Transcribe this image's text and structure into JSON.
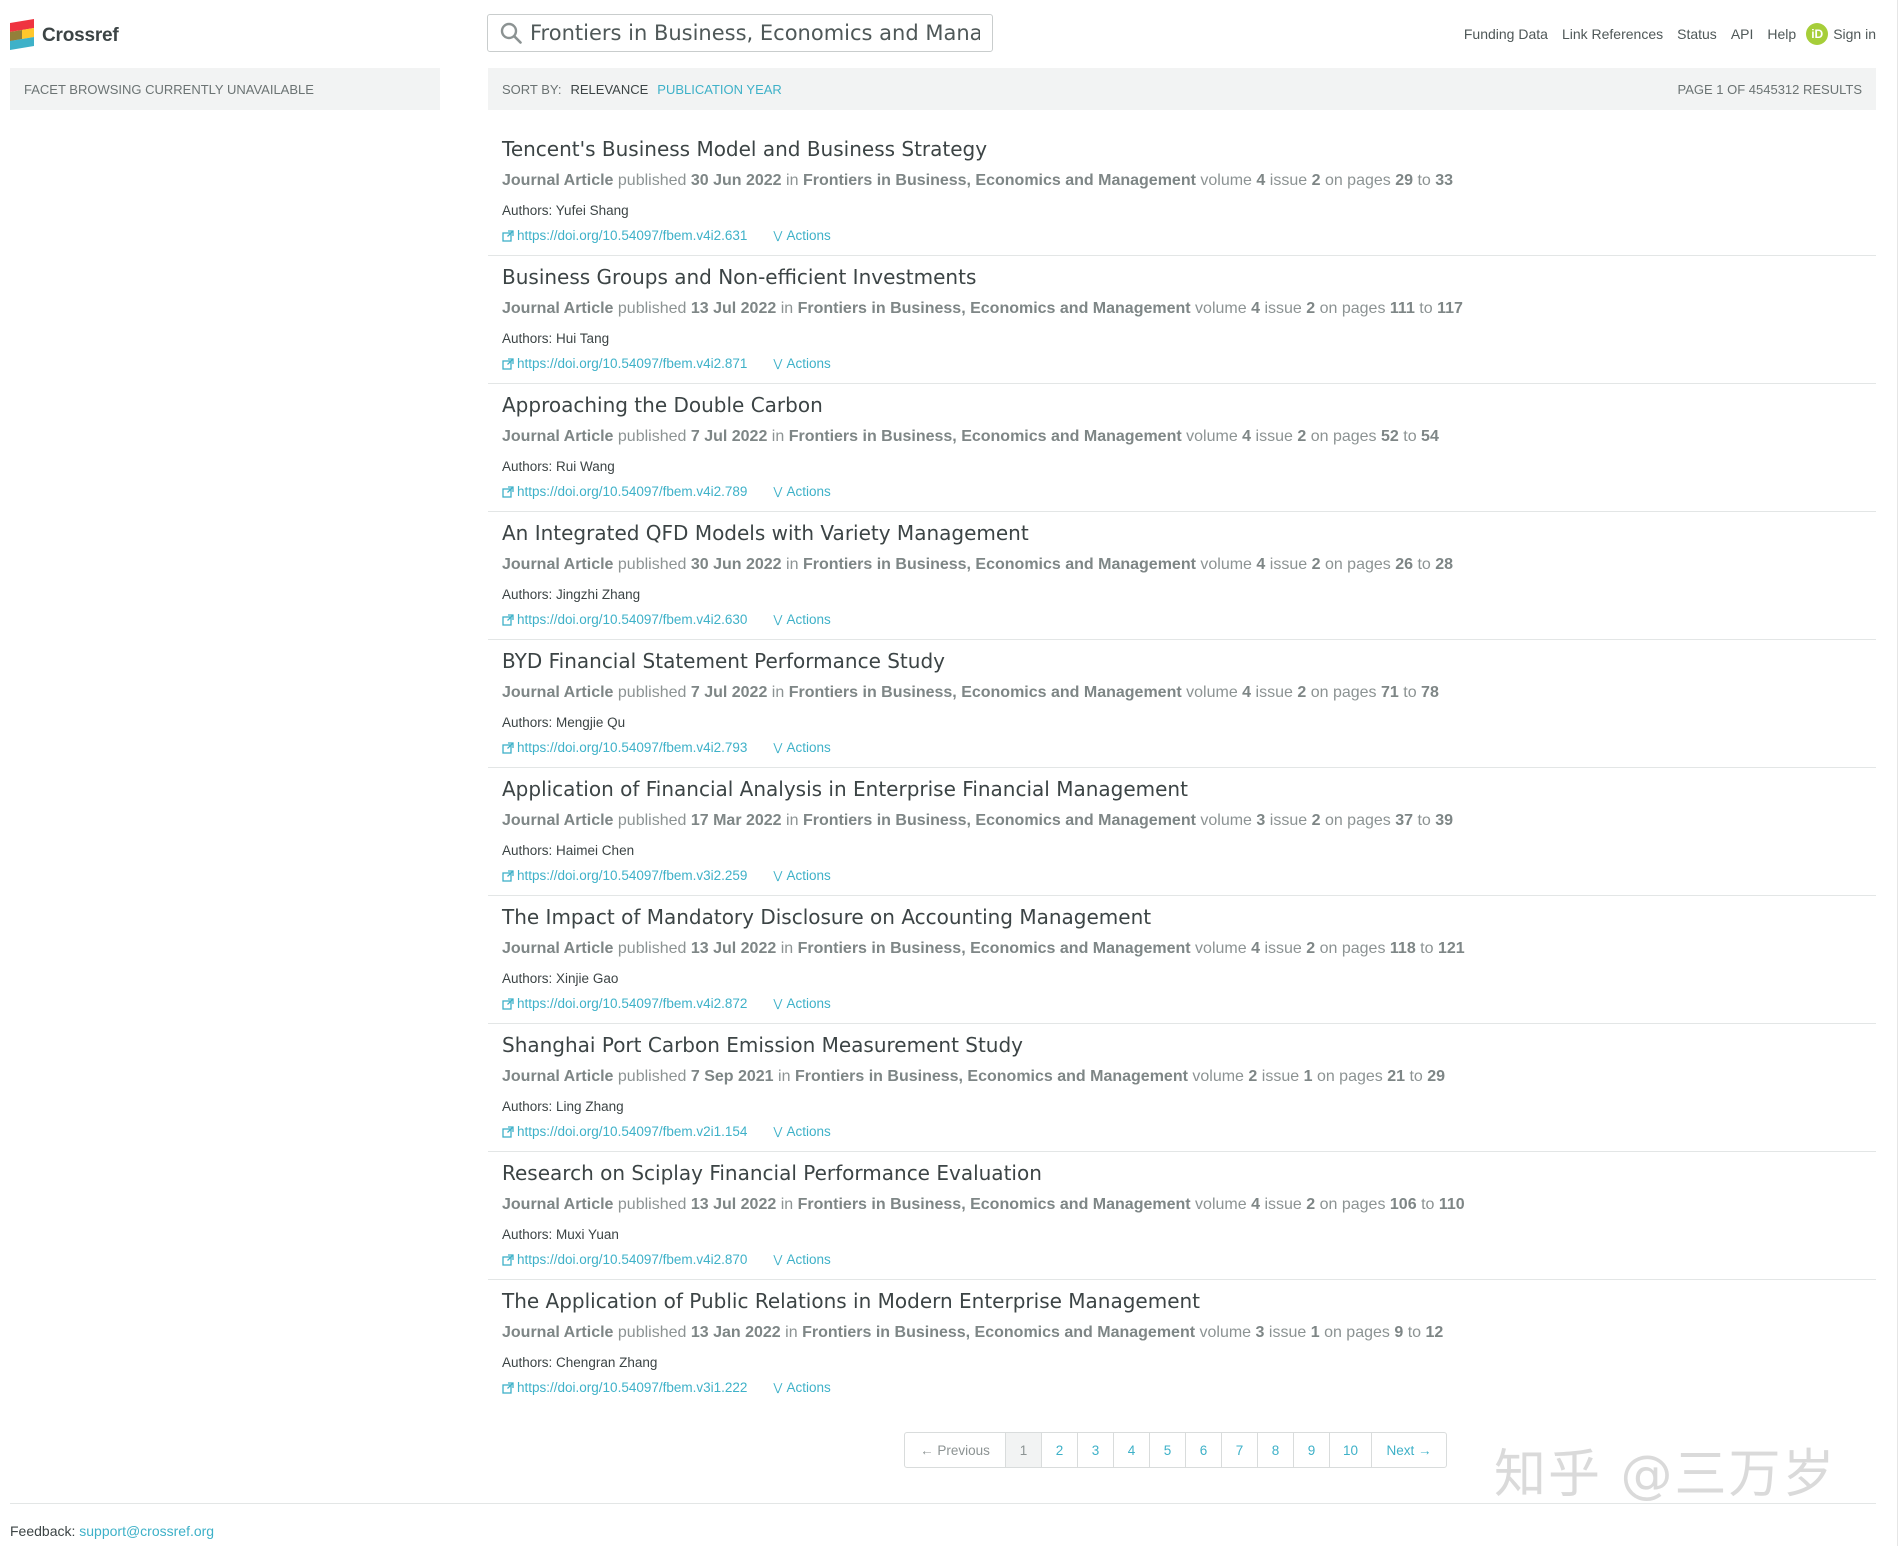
{
  "brand": {
    "name": "Crossref",
    "colors": [
      "#ef3340",
      "#ffc72c",
      "#3eb1c8"
    ]
  },
  "search": {
    "value": "Frontiers in Business, Economics and Management",
    "placeholder": ""
  },
  "nav": {
    "funding_data": "Funding Data",
    "link_references": "Link References",
    "status": "Status",
    "api": "API",
    "help": "Help",
    "orcid_badge": "iD",
    "sign_in": "Sign in"
  },
  "facet": {
    "message": "Facet browsing currently unavailable"
  },
  "sort": {
    "label": "SORT BY:",
    "active": "RELEVANCE",
    "option": "PUBLICATION YEAR",
    "page_info": "PAGE 1 OF 4545312 RESULTS"
  },
  "labels": {
    "published": "published",
    "in": "in",
    "volume": "volume",
    "issue": "issue",
    "on_pages": "on pages",
    "to": "to",
    "authors_prefix": "Authors:",
    "actions": "Actions"
  },
  "results": [
    {
      "title": "Tencent's Business Model and Business Strategy",
      "type": "Journal Article",
      "date": "30 Jun 2022",
      "journal": "Frontiers in Business, Economics and Management",
      "volume": "4",
      "issue": "2",
      "page_start": "29",
      "page_end": "33",
      "authors": "Yufei Shang",
      "doi": "https://doi.org/10.54097/fbem.v4i2.631"
    },
    {
      "title": "Business Groups and Non-efficient Investments",
      "type": "Journal Article",
      "date": "13 Jul 2022",
      "journal": "Frontiers in Business, Economics and Management",
      "volume": "4",
      "issue": "2",
      "page_start": "111",
      "page_end": "117",
      "authors": "Hui Tang",
      "doi": "https://doi.org/10.54097/fbem.v4i2.871"
    },
    {
      "title": "Approaching the Double Carbon",
      "type": "Journal Article",
      "date": "7 Jul 2022",
      "journal": "Frontiers in Business, Economics and Management",
      "volume": "4",
      "issue": "2",
      "page_start": "52",
      "page_end": "54",
      "authors": "Rui Wang",
      "doi": "https://doi.org/10.54097/fbem.v4i2.789"
    },
    {
      "title": "An Integrated QFD Models with Variety Management",
      "type": "Journal Article",
      "date": "30 Jun 2022",
      "journal": "Frontiers in Business, Economics and Management",
      "volume": "4",
      "issue": "2",
      "page_start": "26",
      "page_end": "28",
      "authors": "Jingzhi Zhang",
      "doi": "https://doi.org/10.54097/fbem.v4i2.630"
    },
    {
      "title": "BYD Financial Statement Performance Study",
      "type": "Journal Article",
      "date": "7 Jul 2022",
      "journal": "Frontiers in Business, Economics and Management",
      "volume": "4",
      "issue": "2",
      "page_start": "71",
      "page_end": "78",
      "authors": "Mengjie Qu",
      "doi": "https://doi.org/10.54097/fbem.v4i2.793"
    },
    {
      "title": "Application of Financial Analysis in Enterprise Financial Management",
      "type": "Journal Article",
      "date": "17 Mar 2022",
      "journal": "Frontiers in Business, Economics and Management",
      "volume": "3",
      "issue": "2",
      "page_start": "37",
      "page_end": "39",
      "authors": "Haimei Chen",
      "doi": "https://doi.org/10.54097/fbem.v3i2.259"
    },
    {
      "title": "The Impact of Mandatory Disclosure on Accounting Management",
      "type": "Journal Article",
      "date": "13 Jul 2022",
      "journal": "Frontiers in Business, Economics and Management",
      "volume": "4",
      "issue": "2",
      "page_start": "118",
      "page_end": "121",
      "authors": "Xinjie Gao",
      "doi": "https://doi.org/10.54097/fbem.v4i2.872"
    },
    {
      "title": "Shanghai Port Carbon Emission Measurement Study",
      "type": "Journal Article",
      "date": "7 Sep 2021",
      "journal": "Frontiers in Business, Economics and Management",
      "volume": "2",
      "issue": "1",
      "page_start": "21",
      "page_end": "29",
      "authors": "Ling Zhang",
      "doi": "https://doi.org/10.54097/fbem.v2i1.154"
    },
    {
      "title": "Research on Sciplay Financial Performance Evaluation",
      "type": "Journal Article",
      "date": "13 Jul 2022",
      "journal": "Frontiers in Business, Economics and Management",
      "volume": "4",
      "issue": "2",
      "page_start": "106",
      "page_end": "110",
      "authors": "Muxi Yuan",
      "doi": "https://doi.org/10.54097/fbem.v4i2.870"
    },
    {
      "title": "The Application of Public Relations in Modern Enterprise Management",
      "type": "Journal Article",
      "date": "13 Jan 2022",
      "journal": "Frontiers in Business, Economics and Management",
      "volume": "3",
      "issue": "1",
      "page_start": "9",
      "page_end": "12",
      "authors": "Chengran Zhang",
      "doi": "https://doi.org/10.54097/fbem.v3i1.222"
    }
  ],
  "pagination": {
    "previous": "← Previous",
    "pages": [
      "1",
      "2",
      "3",
      "4",
      "5",
      "6",
      "7",
      "8",
      "9",
      "10"
    ],
    "current": "1",
    "next": "Next →"
  },
  "footer": {
    "label": "Feedback:",
    "email": "support@crossref.org"
  },
  "watermark": "知乎 @三万岁"
}
